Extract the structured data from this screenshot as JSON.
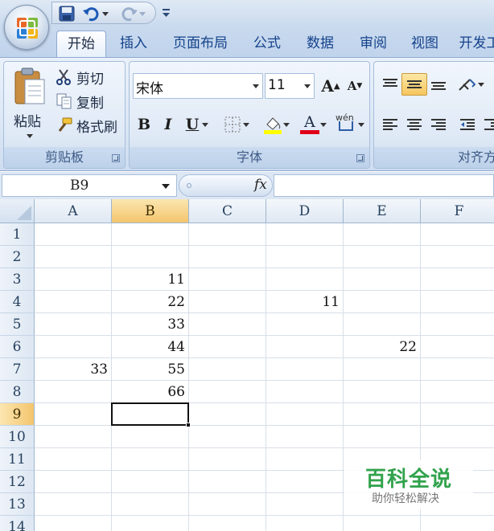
{
  "tabs": [
    "开始",
    "插入",
    "页面布局",
    "公式",
    "数据",
    "审阅",
    "视图",
    "开发工"
  ],
  "ribbon": {
    "clipboard": {
      "paste": "粘贴",
      "cut": "剪切",
      "copy": "复制",
      "format_painter": "格式刷",
      "label": "剪贴板"
    },
    "font": {
      "name": "宋体",
      "size": "11",
      "label": "字体",
      "bold": "B",
      "italic": "I",
      "underline": "U",
      "font_color_glyph": "A",
      "grow_glyph": "A",
      "shrink_glyph": "A",
      "phonetic_glyph": "wén"
    },
    "alignment": {
      "label": "对齐方"
    }
  },
  "formula_bar": {
    "name_box": "B9",
    "fx": "fx",
    "formula": ""
  },
  "columns": [
    "A",
    "B",
    "C",
    "D",
    "E",
    "F"
  ],
  "rows": [
    "1",
    "2",
    "3",
    "4",
    "5",
    "6",
    "7",
    "8",
    "9",
    "10",
    "11",
    "12",
    "13",
    "14"
  ],
  "cells": {
    "B3": "11",
    "B4": "22",
    "B5": "33",
    "B6": "44",
    "B7": "55",
    "B8": "66",
    "D4": "11",
    "E6": "22",
    "A7": "33"
  },
  "selected_cell": "B9",
  "watermark": {
    "title": "百科全说",
    "subtitle": "助你轻松解决"
  },
  "colors": {
    "accent": "#15428b",
    "selection": "#f4c56d",
    "watermark": "#31a24c"
  }
}
